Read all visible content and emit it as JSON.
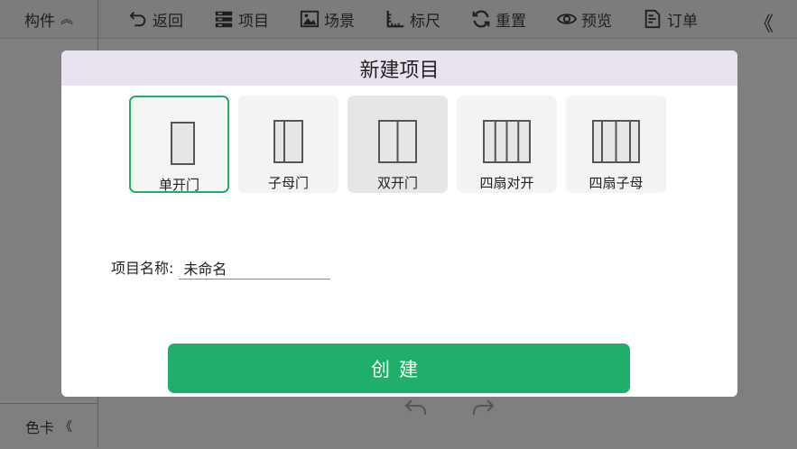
{
  "sidebar": {
    "header_label": "构件",
    "header_icon": "chevrons-up-icon",
    "footer_label": "色卡",
    "footer_icon": "chevrons-left-icon"
  },
  "toolbar": {
    "items": [
      {
        "label": "返回",
        "icon": "undo-arrow-icon"
      },
      {
        "label": "项目",
        "icon": "list-icon"
      },
      {
        "label": "场景",
        "icon": "image-icon"
      },
      {
        "label": "标尺",
        "icon": "ruler-icon"
      },
      {
        "label": "重置",
        "icon": "refresh-icon"
      },
      {
        "label": "预览",
        "icon": "eye-icon"
      },
      {
        "label": "订单",
        "icon": "document-icon"
      }
    ],
    "collapse_icon": "chevrons-left-icon"
  },
  "modal": {
    "title": "新建项目",
    "door_types": [
      {
        "label": "单开门",
        "panels": 1,
        "selected": true
      },
      {
        "label": "子母门",
        "panels": 2,
        "selected": false
      },
      {
        "label": "双开门",
        "panels": 2,
        "selected": false
      },
      {
        "label": "四扇对开",
        "panels": 4,
        "selected": false
      },
      {
        "label": "四扇子母",
        "panels": 4,
        "selected": false
      }
    ],
    "name_label": "项目名称:",
    "name_value": "未命名",
    "create_label": "创建"
  },
  "colors": {
    "accent": "#1fae6b",
    "header_bg": "#e8e3ee",
    "overlay": "#7f7f7f"
  }
}
